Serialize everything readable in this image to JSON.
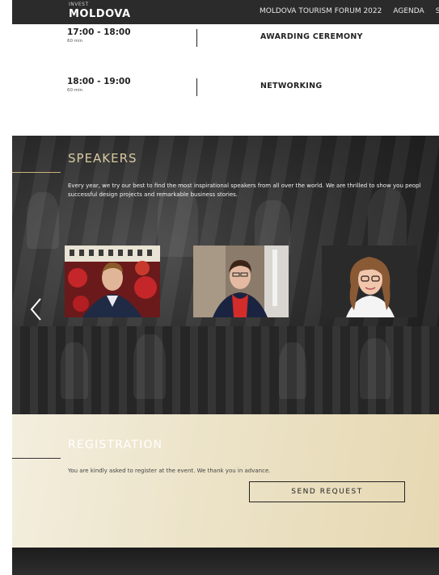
{
  "nav": {
    "logo_small": "INVEST",
    "logo": "MOLDOVA",
    "items": [
      "MOLDOVA TOURISM FORUM 2022",
      "AGENDA",
      "S"
    ]
  },
  "agenda": [
    {
      "time": "17:00 - 18:00",
      "duration": "60 min",
      "event": "AWARDING CEREMONY"
    },
    {
      "time": "18:00 - 19:00",
      "duration": "60 min",
      "event": "NETWORKING"
    }
  ],
  "speakers": {
    "title": "SPEAKERS",
    "description": "Every year, we try our best to find the most inspirational speakers from all over the world. We are thrilled to show you people behind successful design projects and remarkable business stories.",
    "description_visible_line1": "Every year, we try our best to find the most inspirational speakers from all over the world. We are thrilled to show you peopl",
    "description_visible_line2": "successful design projects and remarkable business stories.",
    "prev_icon": "chevron-left-icon"
  },
  "registration": {
    "title": "REGISTRATION",
    "description": "You are kindly asked to register at the event. We thank you in advance.",
    "button_label": "SEND REQUEST"
  },
  "colors": {
    "accent_gold": "#c9b37c",
    "dark_bg": "#2a2a2a",
    "cream_bg": "#ece3c8"
  }
}
